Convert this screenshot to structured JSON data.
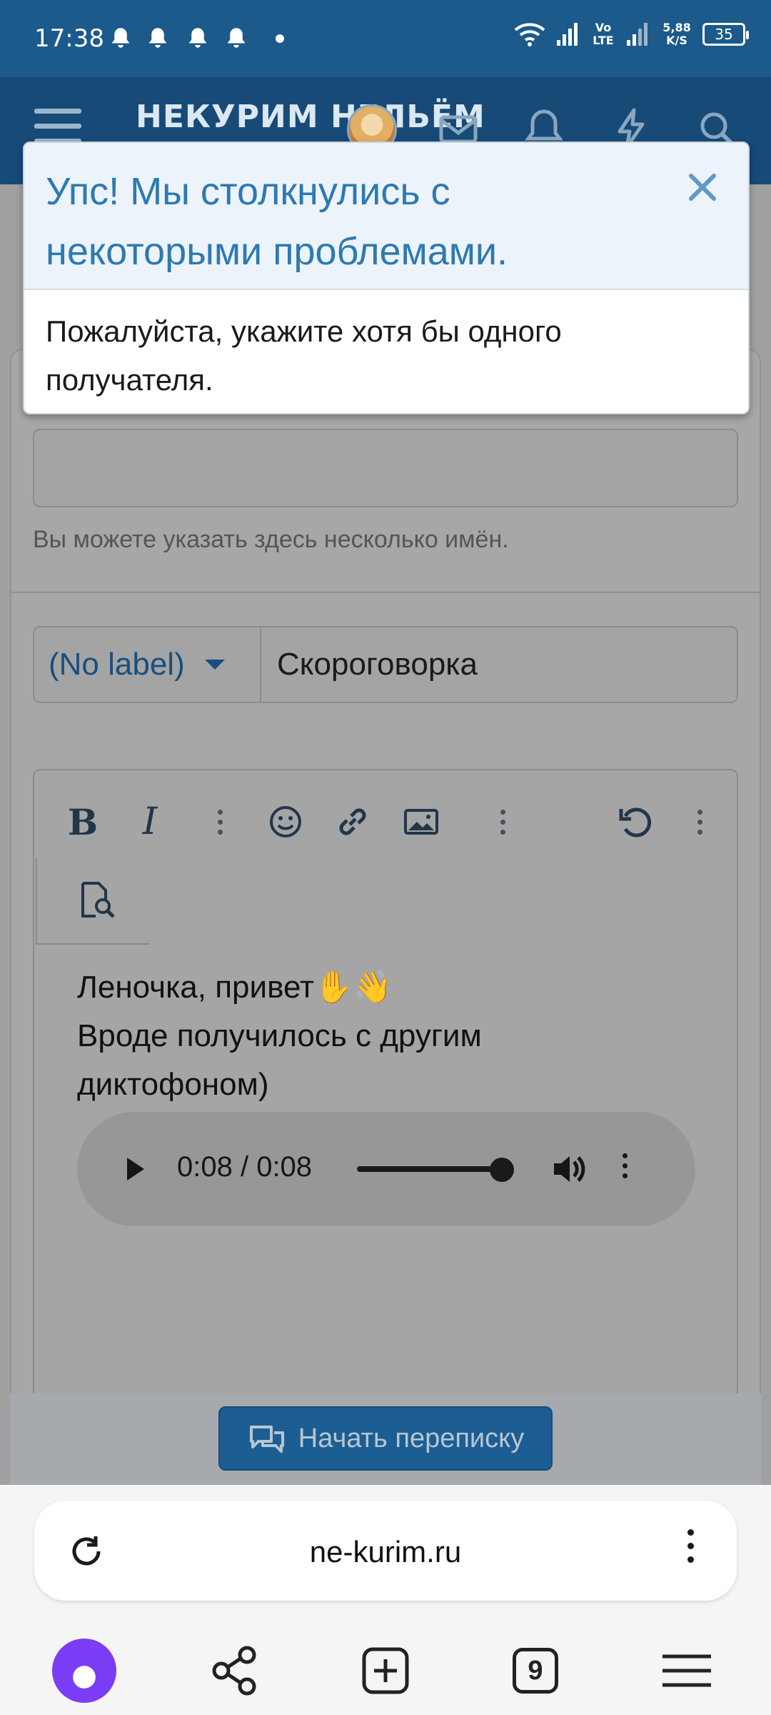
{
  "status_bar": {
    "time": "17:38",
    "network_type": "Vo LTE",
    "speed": "5,88 K/S",
    "battery": "35"
  },
  "header": {
    "logo_text": "НЕКУРИМ НЕЛЬЁМ"
  },
  "alert": {
    "title": "Упс! Мы столкнулись с некоторыми проблемами.",
    "message": "Пожалуйста, укажите хотя бы одного получателя."
  },
  "form": {
    "recipients_hint": "Вы можете указать здесь несколько имён.",
    "label_select": "(No label)",
    "subject_value": "Скороговорка",
    "message_line1": "Леночка, привет✋👋",
    "message_line2": "Вроде получилось с другим",
    "message_line3": "диктофоном)",
    "audio_time": "0:08 / 0:08",
    "audio_progress": 1.0,
    "submit_label": "Начать переписку"
  },
  "browser": {
    "url": "ne-kurim.ru",
    "tabs_count": "9"
  }
}
